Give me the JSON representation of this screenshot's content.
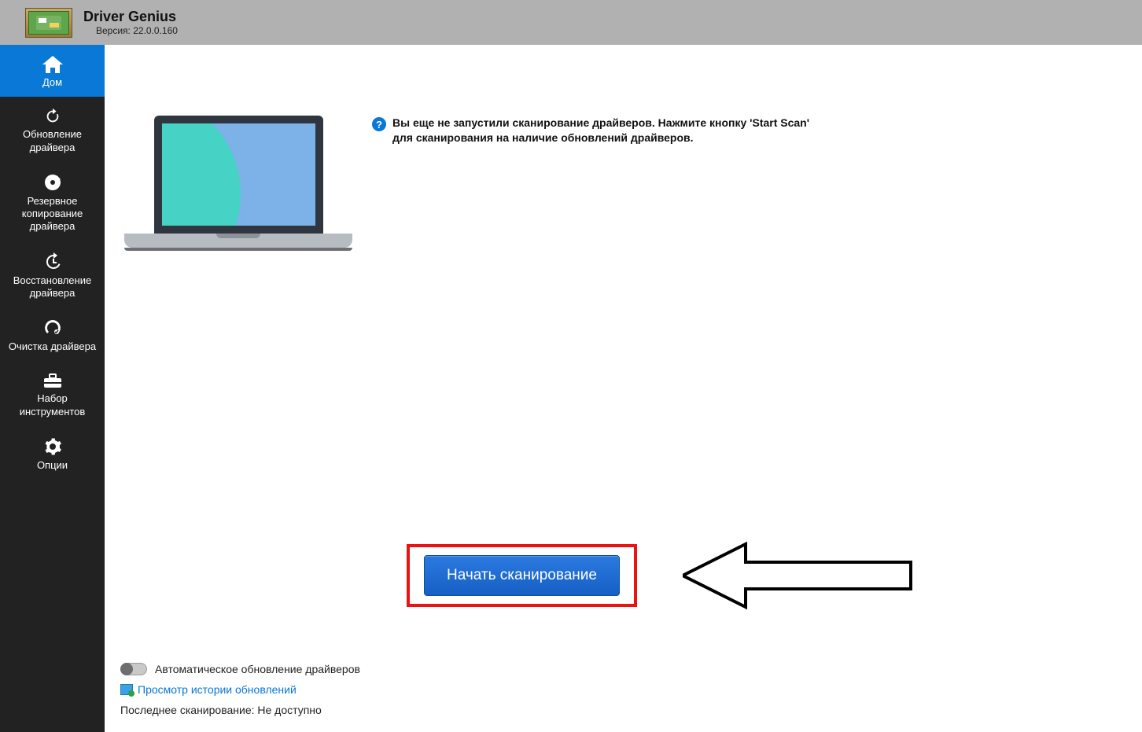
{
  "header": {
    "title": "Driver Genius",
    "version_label": "Версия: 22.0.0.160"
  },
  "sidebar": {
    "items": [
      {
        "label": "Дом"
      },
      {
        "label": "Обновление драйвера"
      },
      {
        "label": "Резервное копирование драйвера"
      },
      {
        "label": "Восстановление драйвера"
      },
      {
        "label": "Очистка драйвера"
      },
      {
        "label": "Набор инструментов"
      },
      {
        "label": "Опции"
      }
    ]
  },
  "main": {
    "info_message": "Вы еще не запустили сканирование драйверов. Нажмите кнопку 'Start Scan' для сканирования на наличие обновлений драйверов.",
    "scan_button": "Начать  сканирование",
    "auto_update_label": "Автоматическое обновление драйверов",
    "history_link": "Просмотр истории обновлений",
    "last_scan": "Последнее сканирование: Не доступно"
  }
}
